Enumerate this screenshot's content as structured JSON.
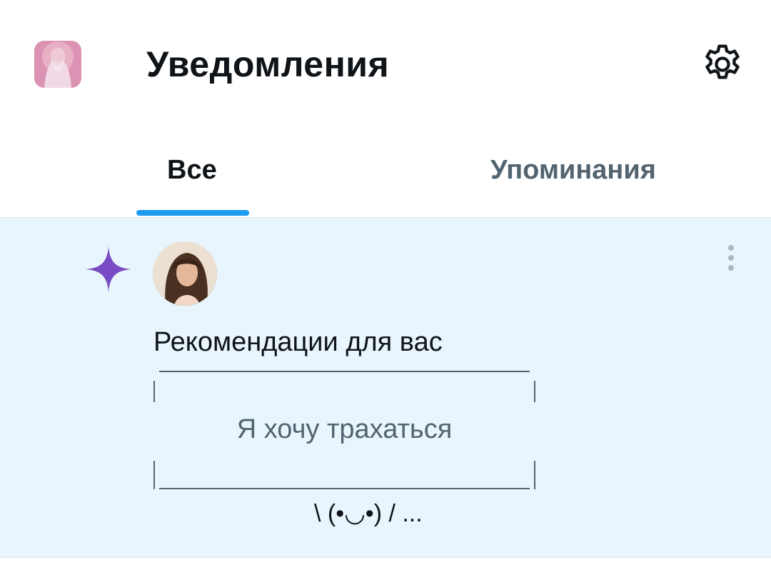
{
  "header": {
    "title": "Уведомления",
    "settings_icon": "gear-icon"
  },
  "tabs": [
    {
      "label": "Все",
      "selected": true
    },
    {
      "label": "Упоминания",
      "selected": false
    }
  ],
  "notification": {
    "icon": "sparkle-icon",
    "icon_color": "#794bc4",
    "text": "Рекомендации для вас",
    "quote_text": "Я хочу трахаться",
    "kaomoji": "\\ (•◡•) / ..."
  },
  "colors": {
    "accent": "#1d9bf0",
    "notification_bg": "#e8f5fd",
    "muted_text": "#536471"
  }
}
